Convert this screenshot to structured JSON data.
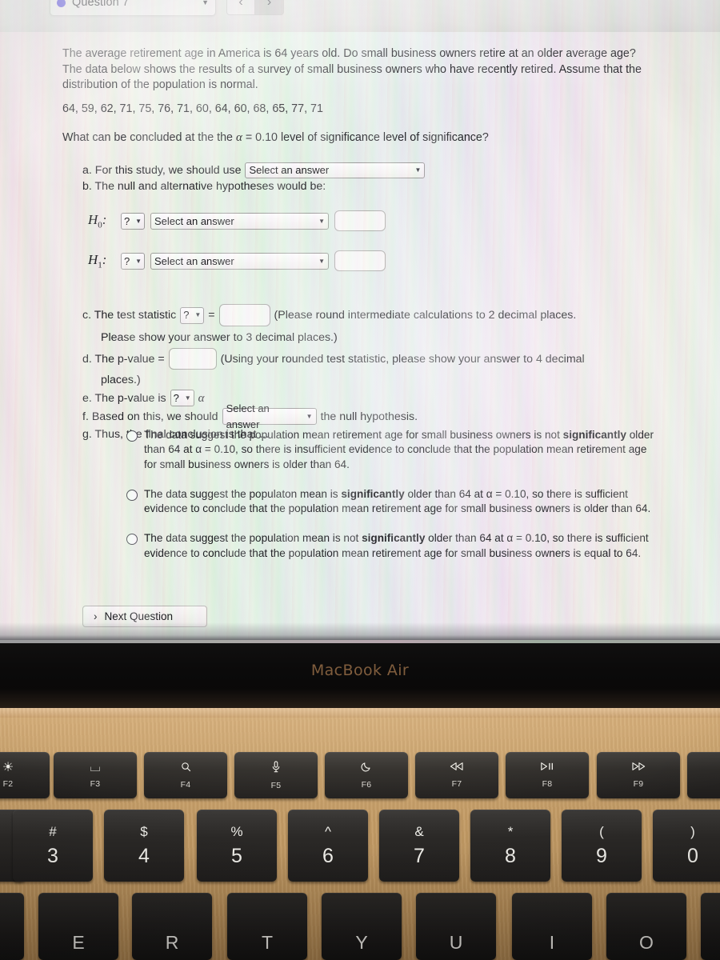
{
  "header": {
    "question_label": "Question 7",
    "status_dot_color": "#2d20d8",
    "dropdown_caret": "▼",
    "prev_arrow": "‹",
    "next_arrow": "›"
  },
  "question": {
    "intro": "The average retirement age in America is 64 years old. Do small business owners retire at an older average age? The data below shows the results of a survey of small business owners who have recently retired. Assume that the distribution of the population is normal.",
    "data_values": "64, 59, 62, 71, 75, 76, 71, 60, 64, 60, 68, 65, 77, 71",
    "ask_prefix": "What can be concluded at the the ",
    "alpha_symbol": "α",
    "ask_suffix": " = 0.10 level of significance level of significance?"
  },
  "parts": {
    "a_text": "a. For this study, we should use",
    "a_select_value": "Select an answer",
    "b_text": "b. The null and alternative hypotheses would be:",
    "h0_name": "H",
    "h0_sub": "0",
    "h1_name": "H",
    "h1_sub": "1",
    "question_select_value": "?",
    "hypothesis_select_value": "Select an answer",
    "h0_input_value": "",
    "h1_input_value": "",
    "c_text": "c. The test statistic",
    "c_equals": "=",
    "c_input_value": "",
    "c_note": "(Please round intermediate calculations to 2 decimal places.",
    "c_note2": "Please show your answer to 3 decimal places.)",
    "d_text": "d. The p-value =",
    "d_input_value": "",
    "d_note": "(Using your rounded test statistic, please show your answer to 4 decimal",
    "d_note2": "places.)",
    "e_text": "e. The p-value is",
    "e_select_value": "?",
    "e_alpha": "α",
    "f_text_before": "f. Based on this, we should",
    "f_select_value": "Select an answer",
    "f_text_after": "the null hypothesis.",
    "g_text": "g. Thus, the final conclusion is that ..."
  },
  "conclusions": [
    {
      "id": "option-1",
      "selected": false,
      "segments": [
        {
          "text": "The data suggest the population mean retirement age for small business owners is not ",
          "bold": false
        },
        {
          "text": "significantly",
          "bold": true
        },
        {
          "text": " older than 64 at α = 0.10, so there is insufficient evidence to conclude that the population mean retirement age for small business owners is older than 64.",
          "bold": false
        }
      ]
    },
    {
      "id": "option-2",
      "selected": false,
      "segments": [
        {
          "text": "The data suggest the populaton mean is ",
          "bold": false
        },
        {
          "text": "significantly",
          "bold": true
        },
        {
          "text": " older than 64 at α = 0.10, so there is sufficient evidence to conclude that the population mean retirement age for small business owners is older than 64.",
          "bold": false
        }
      ]
    },
    {
      "id": "option-3",
      "selected": false,
      "segments": [
        {
          "text": "The data suggest the population mean is not ",
          "bold": false
        },
        {
          "text": "significantly",
          "bold": true
        },
        {
          "text": " older than 64 at α = 0.10, so there is sufficient evidence to conclude that the population mean retirement age for small business owners is equal to 64.",
          "bold": false
        }
      ]
    }
  ],
  "footer": {
    "next_question_arrow": "›",
    "next_question_label": "Next Question"
  },
  "laptop": {
    "brand_text": "MacBook Air",
    "brand_color": "#8a6542",
    "function_keys": [
      {
        "label": "F2",
        "glyph": "☀",
        "icon": "brightness-icon"
      },
      {
        "label": "F3",
        "glyph": "⌸",
        "icon": "mission-control-icon"
      },
      {
        "label": "F4",
        "glyph": "⚲",
        "icon": "search-icon"
      },
      {
        "label": "F5",
        "glyph": "Ἲ4",
        "icon": "microphone-icon"
      },
      {
        "label": "F6",
        "glyph": "☾",
        "icon": "moon-icon"
      },
      {
        "label": "F7",
        "glyph": "⏪",
        "icon": "rewind-icon"
      },
      {
        "label": "F8",
        "glyph": "⏯",
        "icon": "play-pause-icon"
      },
      {
        "label": "F9",
        "glyph": "⏩",
        "icon": "fast-forward-icon"
      }
    ],
    "number_keys": [
      {
        "symbol": "#",
        "number": "3"
      },
      {
        "symbol": "$",
        "number": "4"
      },
      {
        "symbol": "%",
        "number": "5"
      },
      {
        "symbol": "^",
        "number": "6"
      },
      {
        "symbol": "&",
        "number": "7"
      },
      {
        "symbol": "*",
        "number": "8"
      },
      {
        "symbol": "(",
        "number": "9"
      },
      {
        "symbol": ")",
        "number": "0"
      }
    ],
    "letter_keys": [
      "E",
      "R",
      "T",
      "Y",
      "U",
      "I",
      "O"
    ]
  }
}
